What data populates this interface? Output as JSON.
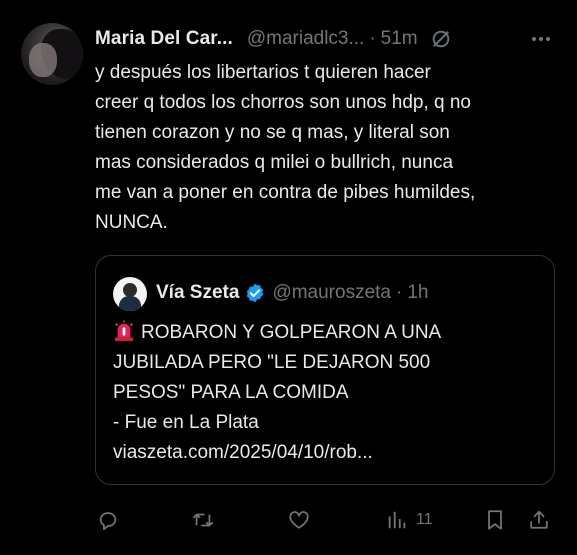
{
  "author": {
    "display_name": "Maria Del Car...",
    "handle": "@mariadlc3...",
    "separator": "·",
    "time": "51m"
  },
  "tweet_text": "y después los libertarios t quieren hacer\ncreer q todos los chorros son unos hdp, q no\ntienen corazon y no se q mas, y literal son\nmas considerados q milei o bullrich, nunca\nme van a poner en contra de pibes humildes,\nNUNCA.",
  "quoted": {
    "display_name": "Vía Szeta",
    "handle": "@mauroszeta",
    "separator": "·",
    "time": "1h",
    "lines": [
      "ROBARON Y GOLPEARON A UNA",
      "JUBILADA PERO \"LE DEJARON 500",
      "PESOS\" PARA LA COMIDA",
      "- Fue en La Plata",
      "viaszeta.com/2025/04/10/rob..."
    ]
  },
  "actions": {
    "views_count": "11"
  },
  "icons": {
    "grok": "grok-icon",
    "more": "more-icon",
    "verified": "verified-badge-icon",
    "siren": "siren-emoji-icon",
    "reply": "reply-icon",
    "retweet": "retweet-icon",
    "like": "like-icon",
    "views": "views-icon",
    "bookmark": "bookmark-icon",
    "share": "share-icon"
  },
  "colors": {
    "background": "#000000",
    "text_primary": "#e7e9ea",
    "text_secondary": "#71767b",
    "border": "#2f3336",
    "verified": "#1d9bf0"
  }
}
